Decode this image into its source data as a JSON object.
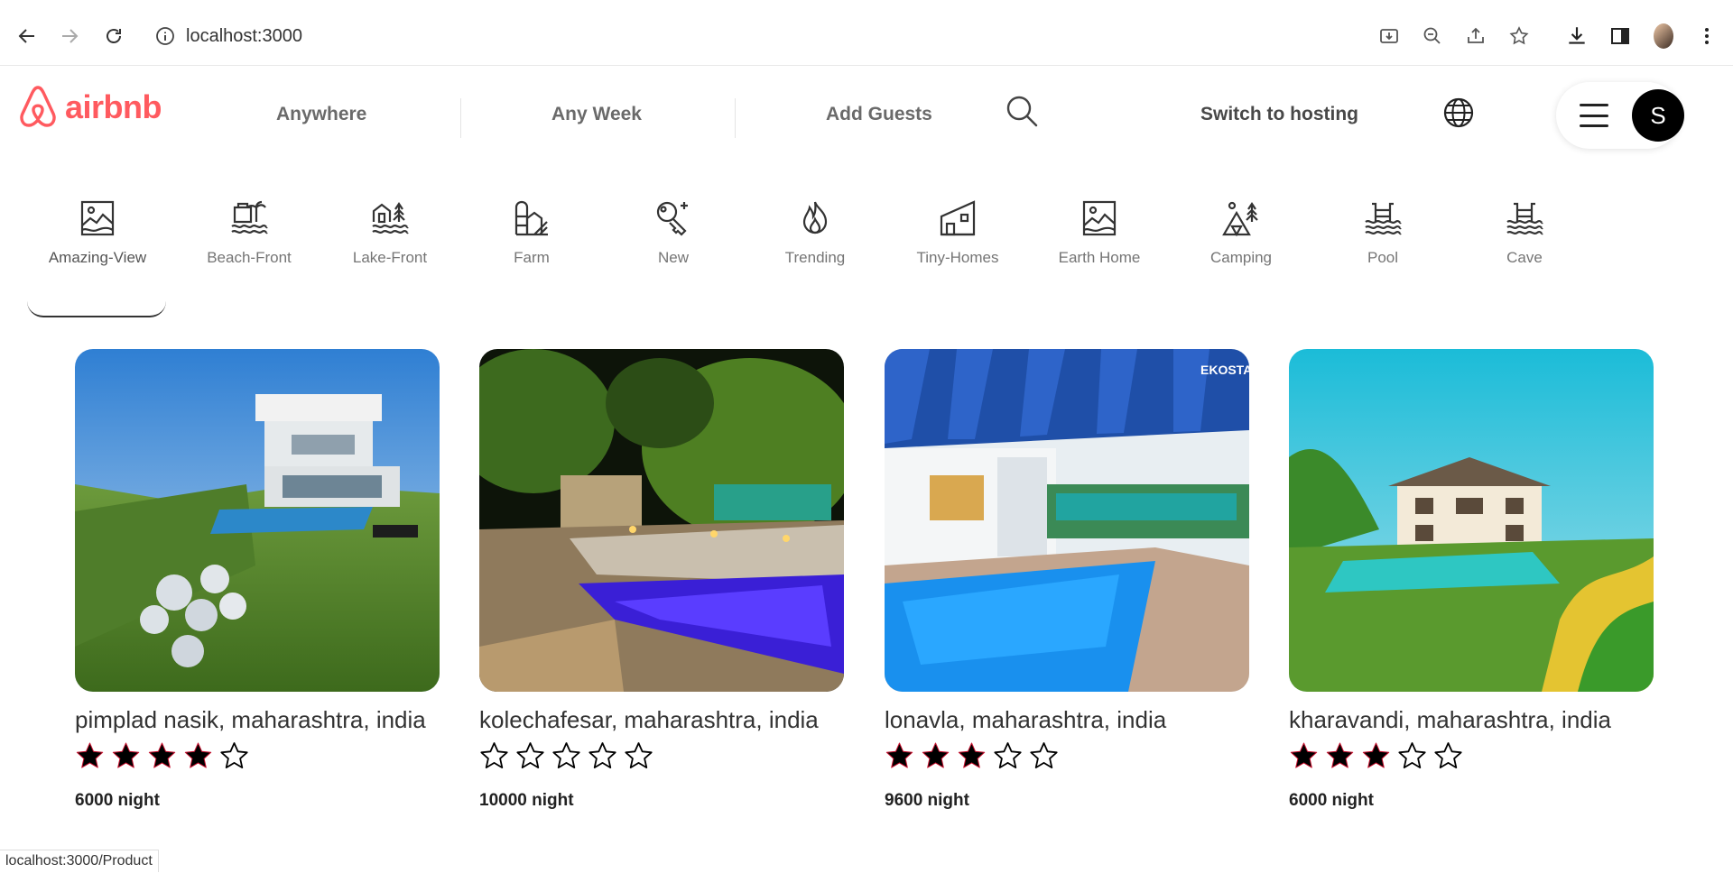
{
  "browser": {
    "url": "localhost:3000",
    "status_url": "localhost:3000/Product"
  },
  "header": {
    "logo_text": "airbnb",
    "anywhere": "Anywhere",
    "any_week": "Any Week",
    "add_guests": "Add Guests",
    "switch_hosting": "Switch to hosting",
    "avatar_initial": "S",
    "brand_color": "#ff5a5f"
  },
  "categories": [
    {
      "label": "Amazing-View",
      "icon": "amazing-view-icon",
      "active": true
    },
    {
      "label": "Beach-Front",
      "icon": "beach-front-icon"
    },
    {
      "label": "Lake-Front",
      "icon": "lake-front-icon"
    },
    {
      "label": "Farm",
      "icon": "farm-icon"
    },
    {
      "label": "New",
      "icon": "new-icon"
    },
    {
      "label": "Trending",
      "icon": "trending-icon"
    },
    {
      "label": "Tiny-Homes",
      "icon": "tiny-homes-icon"
    },
    {
      "label": "Earth Home",
      "icon": "earth-home-icon"
    },
    {
      "label": "Camping",
      "icon": "camping-icon"
    },
    {
      "label": "Pool",
      "icon": "pool-icon"
    },
    {
      "label": "Cave",
      "icon": "cave-icon"
    }
  ],
  "listings": [
    {
      "location": "pimplad nasik, maharashtra, india",
      "rating": 4,
      "price": "6000 night"
    },
    {
      "location": "kolechafesar, maharashtra, india",
      "rating": 0,
      "price": "10000 night"
    },
    {
      "location": "lonavla, maharashtra, india",
      "rating": 3,
      "price": "9600 night",
      "photo_watermark": "EKOSTAY"
    },
    {
      "location": "kharavandi, maharashtra, india",
      "rating": 3,
      "price": "6000 night"
    }
  ]
}
